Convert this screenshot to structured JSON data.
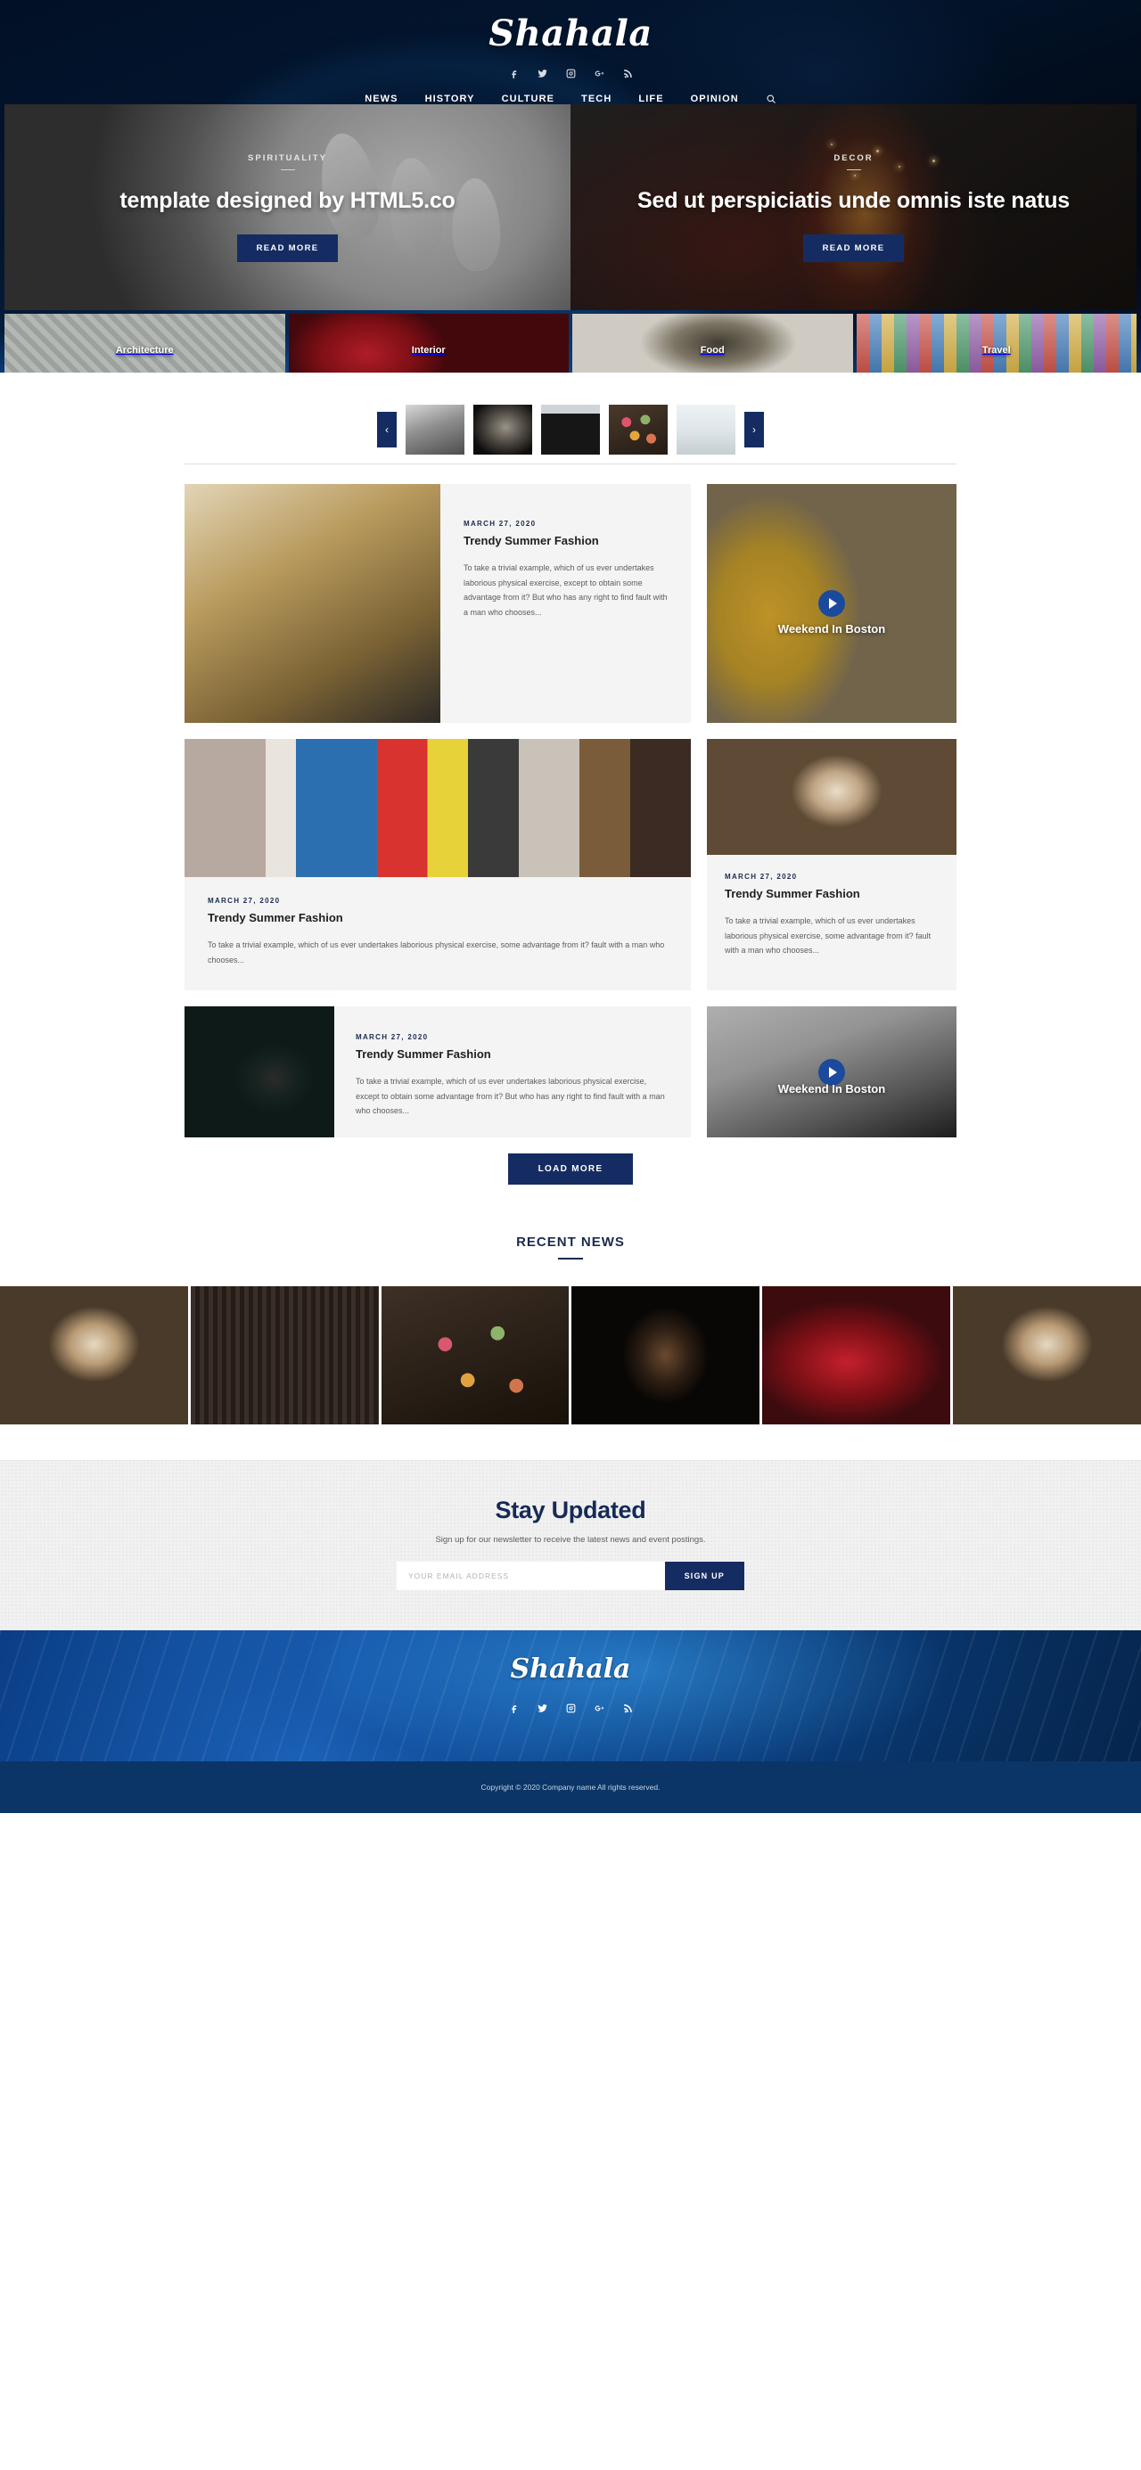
{
  "header": {
    "brand": "Shahala",
    "social": [
      {
        "name": "facebook-icon",
        "label": "Facebook"
      },
      {
        "name": "twitter-icon",
        "label": "Twitter"
      },
      {
        "name": "instagram-icon",
        "label": "Instagram"
      },
      {
        "name": "google-plus-icon",
        "label": "Google Plus"
      },
      {
        "name": "rss-icon",
        "label": "RSS"
      }
    ],
    "nav": [
      {
        "label": "NEWS"
      },
      {
        "label": "HISTORY"
      },
      {
        "label": "CULTURE"
      },
      {
        "label": "TECH"
      },
      {
        "label": "LIFE"
      },
      {
        "label": "OPINION"
      }
    ],
    "search_label": "Search"
  },
  "hero": {
    "left": {
      "category": "SPIRITUALITY",
      "title": "template designed by HTML5.co",
      "cta": "READ MORE"
    },
    "right": {
      "category": "DECOR",
      "title": "Sed ut perspiciatis unde omnis iste natus",
      "cta": "READ MORE"
    }
  },
  "categories": [
    {
      "label": "Architecture"
    },
    {
      "label": "Interior"
    },
    {
      "label": "Food"
    },
    {
      "label": "Travel"
    }
  ],
  "carousel": {
    "prev_label": "‹",
    "next_label": "›",
    "thumbs": [
      {
        "name": "thumb-portrait-woman"
      },
      {
        "name": "thumb-dog"
      },
      {
        "name": "thumb-black-cat"
      },
      {
        "name": "thumb-macarons"
      },
      {
        "name": "thumb-snow-forest"
      }
    ]
  },
  "posts": {
    "row1": {
      "article": {
        "date": "MARCH 27, 2020",
        "title": "Trendy Summer Fashion",
        "excerpt": "To take a trivial example, which of us ever undertakes laborious physical exercise, except to obtain some advantage from it? But who has any right to find fault with a man who chooses..."
      },
      "video": {
        "title": "Weekend In Boston"
      }
    },
    "row2": {
      "left": {
        "date": "MARCH 27, 2020",
        "title": "Trendy Summer Fashion",
        "excerpt": "To take a trivial example, which of us ever undertakes laborious physical exercise, some advantage from it? fault with a man who chooses..."
      },
      "right": {
        "date": "MARCH 27, 2020",
        "title": "Trendy Summer Fashion",
        "excerpt": "To take a trivial example, which of us ever undertakes laborious physical exercise, some advantage from it? fault with a man who chooses..."
      }
    },
    "row3": {
      "article": {
        "date": "MARCH 27, 2020",
        "title": "Trendy Summer Fashion",
        "excerpt": "To take a trivial example, which of us ever undertakes laborious physical exercise, except to obtain some advantage from it? But who has any right to find fault with a man who chooses..."
      },
      "video": {
        "title": "Weekend In Boston"
      }
    },
    "load_more": "LOAD MORE"
  },
  "recent_news": {
    "heading": "RECENT NEWS",
    "items": [
      {
        "name": "recent-item-dessert-jar"
      },
      {
        "name": "recent-item-silhouette-curtain"
      },
      {
        "name": "recent-item-macarons"
      },
      {
        "name": "recent-item-dark-cup"
      },
      {
        "name": "recent-item-red-dress"
      },
      {
        "name": "recent-item-dessert-jar-2"
      }
    ]
  },
  "newsletter": {
    "heading": "Stay Updated",
    "subtext": "Sign up for our newsletter to receive the latest news and event postings.",
    "placeholder": "YOUR EMAIL ADDRESS",
    "value": "",
    "button": "SIGN UP"
  },
  "footer": {
    "brand": "Shahala",
    "social": [
      {
        "name": "facebook-icon"
      },
      {
        "name": "twitter-icon"
      },
      {
        "name": "instagram-icon"
      },
      {
        "name": "google-plus-icon"
      },
      {
        "name": "rss-icon"
      }
    ],
    "copyright": "Copyright © 2020 Company name All rights reserved."
  },
  "colors": {
    "accent": "#152c63",
    "dark_navy": "#0b1b3a",
    "footer_blue": "#1b62b8",
    "play_blue": "#1b4a9c"
  }
}
